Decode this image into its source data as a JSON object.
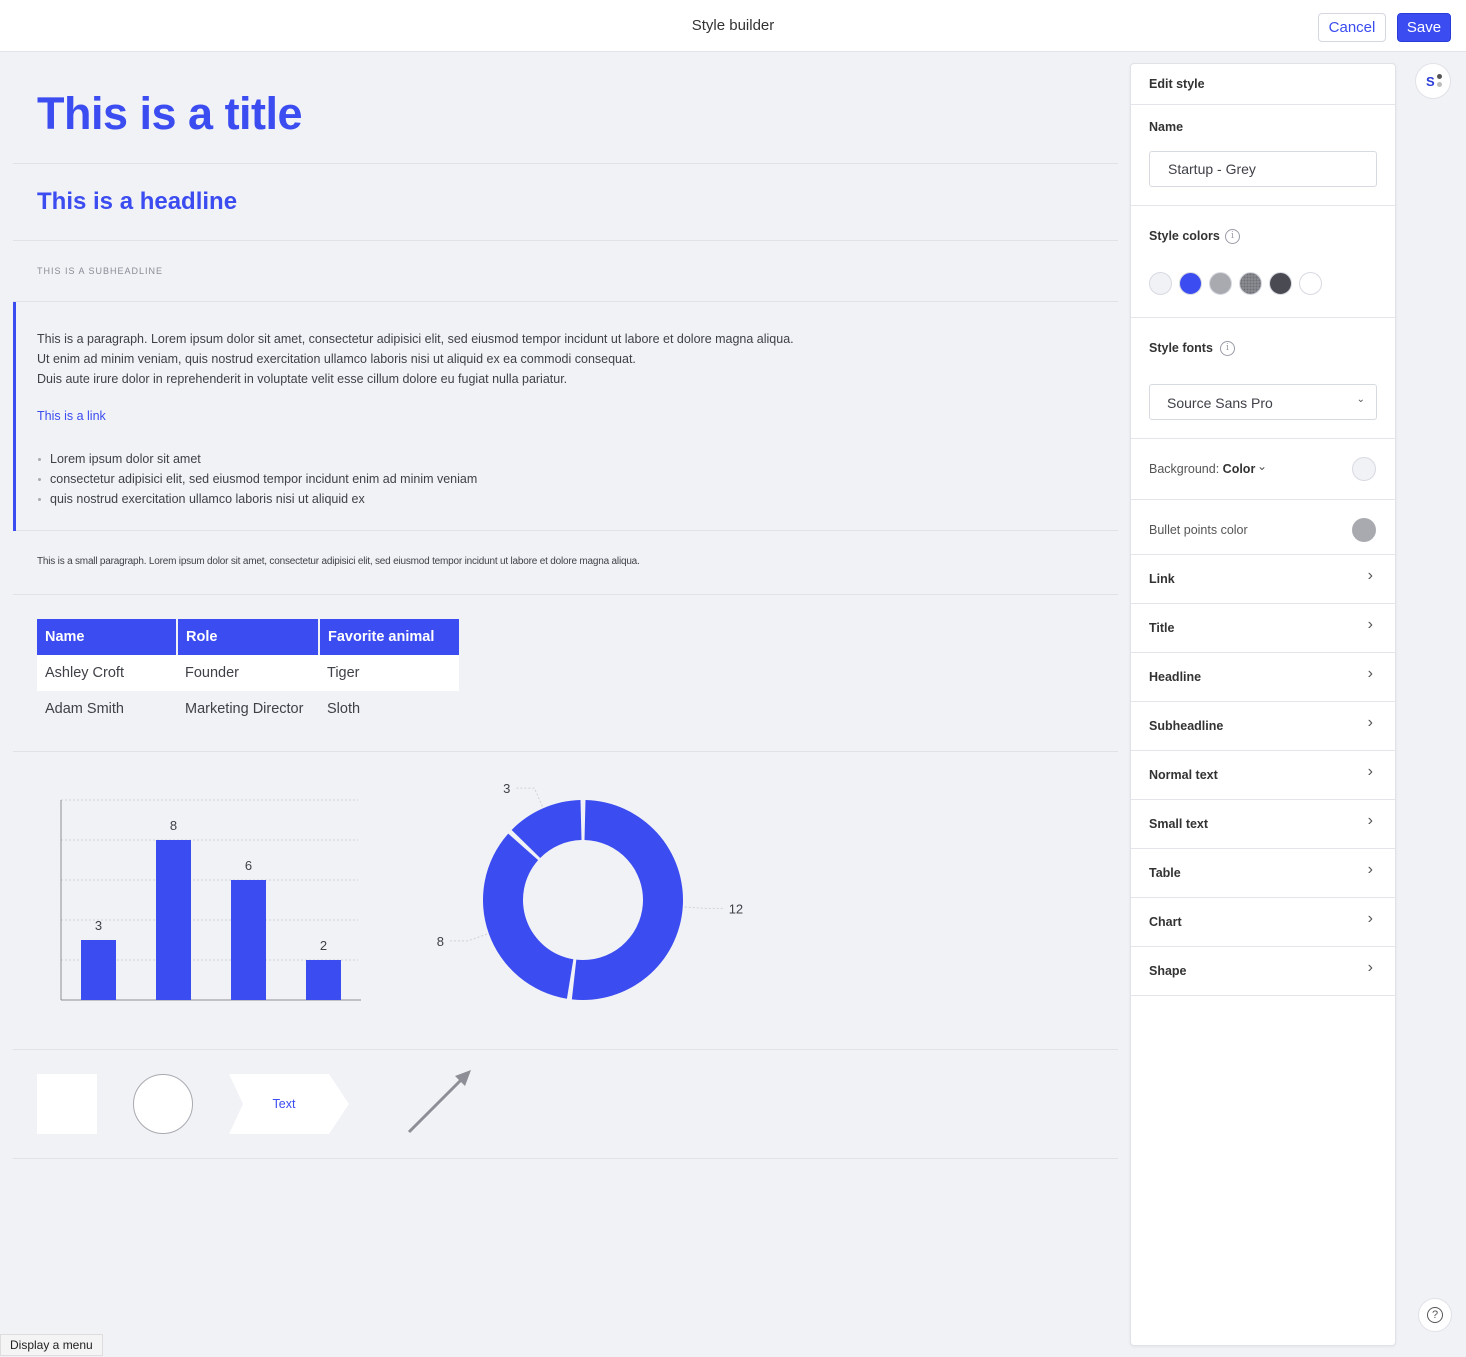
{
  "header": {
    "title": "Style builder",
    "cancel_label": "Cancel",
    "save_label": "Save"
  },
  "canvas": {
    "title": "This is a title",
    "headline": "This is a headline",
    "subheadline": "This is a subheadline",
    "paragraph_lines": [
      "This is a paragraph. Lorem ipsum dolor sit amet, consectetur adipisici elit, sed eiusmod tempor incidunt ut labore et dolore magna aliqua.",
      "Ut enim ad minim veniam, quis nostrud exercitation ullamco laboris nisi ut aliquid ex ea commodi consequat.",
      "Duis aute irure dolor in reprehenderit in voluptate velit esse cillum dolore eu fugiat nulla pariatur."
    ],
    "link": "This is a link",
    "bullets": [
      "Lorem ipsum dolor sit amet",
      "consectetur adipisici elit, sed eiusmod tempor incidunt enim ad minim veniam",
      "quis nostrud exercitation ullamco laboris nisi ut aliquid ex"
    ],
    "small_paragraph": "This is a small paragraph. Lorem ipsum dolor sit amet, consectetur adipisici elit, sed eiusmod tempor incidunt ut labore et dolore magna aliqua.",
    "table": {
      "headers": [
        "Name",
        "Role",
        "Favorite animal"
      ],
      "rows": [
        [
          "Ashley Croft",
          "Founder",
          "Tiger"
        ],
        [
          "Adam Smith",
          "Marketing Director",
          "Sloth"
        ]
      ]
    },
    "shape_text": "Text"
  },
  "chart_data": [
    {
      "type": "bar",
      "categories": [
        "",
        "",
        "",
        ""
      ],
      "values": [
        3,
        8,
        6,
        2
      ],
      "ylim": [
        0,
        10
      ],
      "grid": true,
      "data_labels": true,
      "color": "#3b4cf0"
    },
    {
      "type": "pie",
      "donut": true,
      "values": [
        3,
        12,
        8
      ],
      "data_labels": true,
      "color": "#3b4cf0"
    }
  ],
  "panel": {
    "heading": "Edit style",
    "name_label": "Name",
    "name_value": "Startup - Grey",
    "colors_label": "Style colors",
    "colors": [
      "#f1f2f6",
      "#3b4cf0",
      "#a9aab0",
      "#8e8f96",
      "#4a4b52",
      "#ffffff"
    ],
    "fonts_label": "Style fonts",
    "font_value": "Source Sans Pro",
    "background_label": "Background:",
    "background_mode": "Color",
    "background_color": "#f1f2f6",
    "bullet_label": "Bullet points color",
    "bullet_color": "#a9aab0",
    "rows": [
      "Link",
      "Title",
      "Headline",
      "Subheadline",
      "Normal text",
      "Small text",
      "Table",
      "Chart",
      "Shape"
    ]
  },
  "footer": {
    "display_menu": "Display a menu"
  },
  "colors": {
    "accent": "#3b4cf0",
    "background": "#f1f2f6"
  }
}
